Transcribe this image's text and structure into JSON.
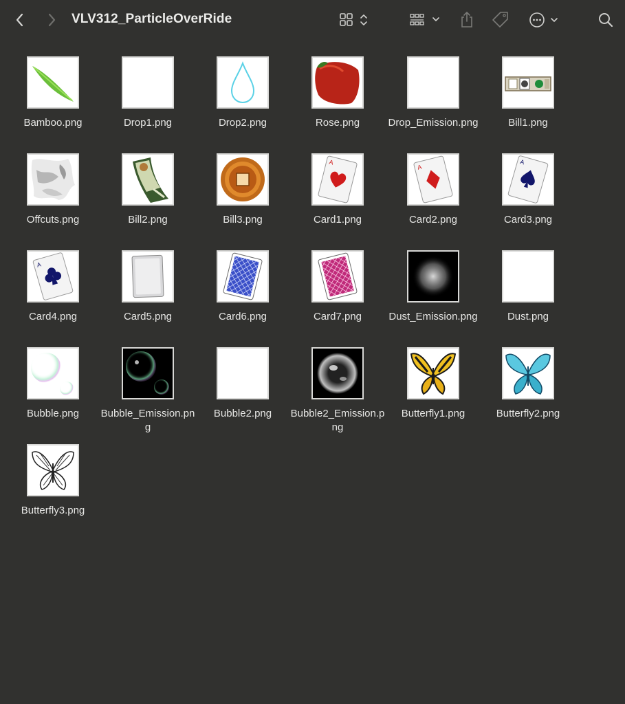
{
  "window": {
    "title": "VLV312_ParticleOverRide"
  },
  "toolbar": {
    "back_icon": "chevron-left-icon",
    "forward_icon": "chevron-right-icon",
    "view_icon": "grid-view-icon",
    "group_icon": "group-by-icon",
    "share_icon": "share-icon",
    "tag_icon": "tag-icon",
    "more_icon": "ellipsis-circle-icon",
    "search_icon": "search-icon"
  },
  "files": [
    {
      "name": "Bamboo.png",
      "thumb": "bamboo"
    },
    {
      "name": "Drop1.png",
      "thumb": "blank"
    },
    {
      "name": "Drop2.png",
      "thumb": "drop"
    },
    {
      "name": "Rose.png",
      "thumb": "rose"
    },
    {
      "name": "Drop_Emission.png",
      "thumb": "blank"
    },
    {
      "name": "Bill1.png",
      "thumb": "bill1"
    },
    {
      "name": "Offcuts.png",
      "thumb": "offcuts"
    },
    {
      "name": "Bill2.png",
      "thumb": "bill2"
    },
    {
      "name": "Bill3.png",
      "thumb": "coin"
    },
    {
      "name": "Card1.png",
      "thumb": "card-heart"
    },
    {
      "name": "Card2.png",
      "thumb": "card-diamond"
    },
    {
      "name": "Card3.png",
      "thumb": "card-spade"
    },
    {
      "name": "Card4.png",
      "thumb": "card-club"
    },
    {
      "name": "Card5.png",
      "thumb": "card-blank"
    },
    {
      "name": "Card6.png",
      "thumb": "card-back-blue"
    },
    {
      "name": "Card7.png",
      "thumb": "card-back-pink"
    },
    {
      "name": "Dust_Emission.png",
      "thumb": "dust"
    },
    {
      "name": "Dust.png",
      "thumb": "blank"
    },
    {
      "name": "Bubble.png",
      "thumb": "bubble"
    },
    {
      "name": "Bubble_Emission.png",
      "thumb": "bubble-dark"
    },
    {
      "name": "Bubble2.png",
      "thumb": "blank"
    },
    {
      "name": "Bubble2_Emission.png",
      "thumb": "bubble2-dark"
    },
    {
      "name": "Butterfly1.png",
      "thumb": "butterfly-yellow"
    },
    {
      "name": "Butterfly2.png",
      "thumb": "butterfly-blue"
    },
    {
      "name": "Butterfly3.png",
      "thumb": "butterfly-sketch"
    }
  ]
}
